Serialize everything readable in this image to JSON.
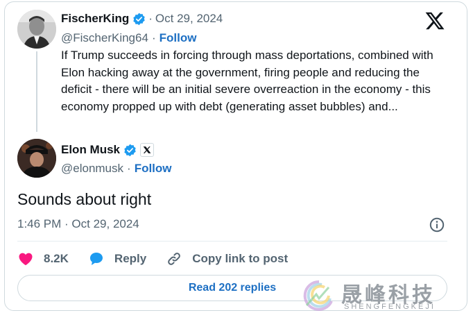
{
  "quoted": {
    "display_name": "FischerKing",
    "date": "Oct 29, 2024",
    "handle": "@FischerKing64",
    "follow_label": "Follow",
    "text": "If Trump succeeds in forcing through mass deportations, combined with Elon hacking away at the government, firing people and reducing the deficit - there will be an initial severe overreaction in the economy - this economy propped up with debt (generating asset bubbles) and..."
  },
  "reply": {
    "display_name": "Elon Musk",
    "handle": "@elonmusk",
    "follow_label": "Follow",
    "text": "Sounds about right",
    "timestamp": "1:46 PM · Oct 29, 2024"
  },
  "actions": {
    "likes": "8.2K",
    "reply_label": "Reply",
    "copy_link_label": "Copy link to post"
  },
  "read_replies_label": "Read 202 replies",
  "separator": "·",
  "watermark": {
    "title": "晟峰科技",
    "subtitle": "SHENGFENGKEJI"
  },
  "colors": {
    "link": "#1d6fc3",
    "verified": "#1d9bf0",
    "like": "#f91880",
    "reply_icon": "#1d9bf0",
    "muted": "#536471"
  },
  "icons": [
    "verified-badge-icon",
    "x-logo-icon",
    "x-affiliate-badge-icon",
    "info-icon",
    "heart-icon",
    "reply-bubble-icon",
    "link-icon"
  ]
}
